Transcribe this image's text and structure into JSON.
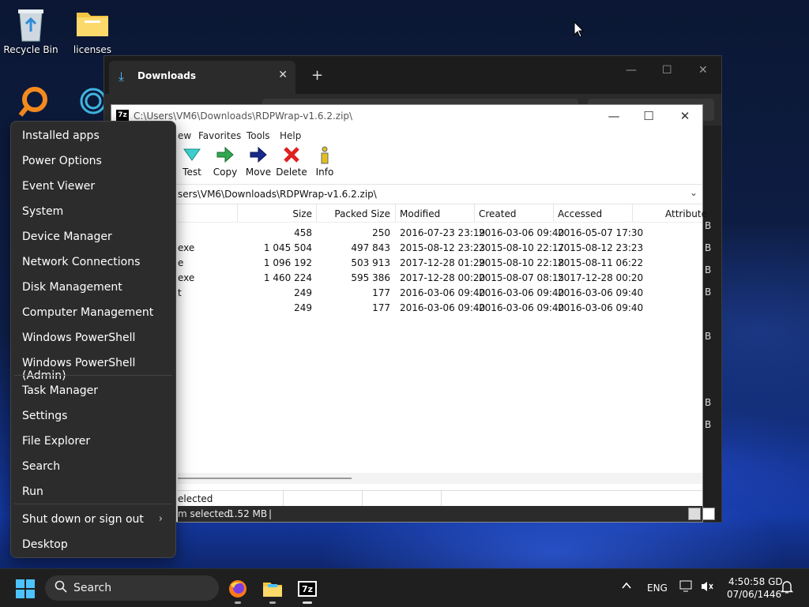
{
  "desktop": {
    "icons": [
      {
        "label": "Recycle Bin"
      },
      {
        "label": "licenses"
      }
    ]
  },
  "explorer": {
    "tab_title": "Downloads",
    "new_tab": "+",
    "side_letters": [
      "B",
      "B",
      "B",
      "B",
      "B",
      "B",
      "B"
    ]
  },
  "sevenzip": {
    "title_path": "C:\\Users\\VM6\\Downloads\\RDPWrap-v1.6.2.zip\\",
    "menu": [
      "ew",
      "Favorites",
      "Tools",
      "Help"
    ],
    "tools": [
      {
        "label": "Test",
        "icon": "test-icon"
      },
      {
        "label": "Copy",
        "icon": "copy-icon"
      },
      {
        "label": "Move",
        "icon": "move-icon"
      },
      {
        "label": "Delete",
        "icon": "delete-icon"
      },
      {
        "label": "Info",
        "icon": "info-icon"
      }
    ],
    "address": "sers\\VM6\\Downloads\\RDPWrap-v1.6.2.zip\\",
    "columns": [
      "Size",
      "Packed Size",
      "Modified",
      "Created",
      "Accessed",
      "Attribute"
    ],
    "rows": [
      {
        "name": "",
        "size": "458",
        "packed": "250",
        "modified": "2016-07-23 23:19",
        "created": "2016-03-06 09:40",
        "accessed": "2016-05-07 17:30"
      },
      {
        "name": "exe",
        "size": "1 045 504",
        "packed": "497 843",
        "modified": "2015-08-12 23:23",
        "created": "2015-08-10 22:17",
        "accessed": "2015-08-12 23:23"
      },
      {
        "name": "e",
        "size": "1 096 192",
        "packed": "503 913",
        "modified": "2017-12-28 01:29",
        "created": "2015-08-10 22:18",
        "accessed": "2015-08-11 06:22"
      },
      {
        "name": "exe",
        "size": "1 460 224",
        "packed": "595 386",
        "modified": "2017-12-28 00:20",
        "created": "2015-08-07 08:15",
        "accessed": "2017-12-28 00:20"
      },
      {
        "name": "t",
        "size": "249",
        "packed": "177",
        "modified": "2016-03-06 09:40",
        "created": "2016-03-06 09:40",
        "accessed": "2016-03-06 09:40"
      },
      {
        "name": "",
        "size": "249",
        "packed": "177",
        "modified": "2016-03-06 09:40",
        "created": "2016-03-06 09:40",
        "accessed": "2016-03-06 09:40"
      }
    ],
    "status_selected": "elected",
    "status_item": "m selected",
    "status_size": "1.52 MB",
    "status_bar": "|"
  },
  "winx_menu": {
    "items": [
      "Installed apps",
      "Power Options",
      "Event Viewer",
      "System",
      "Device Manager",
      "Network Connections",
      "Disk Management",
      "Computer Management",
      "Windows PowerShell",
      "Windows PowerShell (Admin)",
      "Task Manager",
      "Settings",
      "File Explorer",
      "Search",
      "Run",
      "Shut down or sign out",
      "Desktop"
    ]
  },
  "taskbar": {
    "search_label": "Search",
    "language": "ENG",
    "time": "4:50:58 GD",
    "date": "07/06/1446"
  },
  "colors": {
    "accent": "#4cc2ff",
    "menu_bg": "#2c2c2c",
    "taskbar_bg": "#1f1f1f"
  }
}
